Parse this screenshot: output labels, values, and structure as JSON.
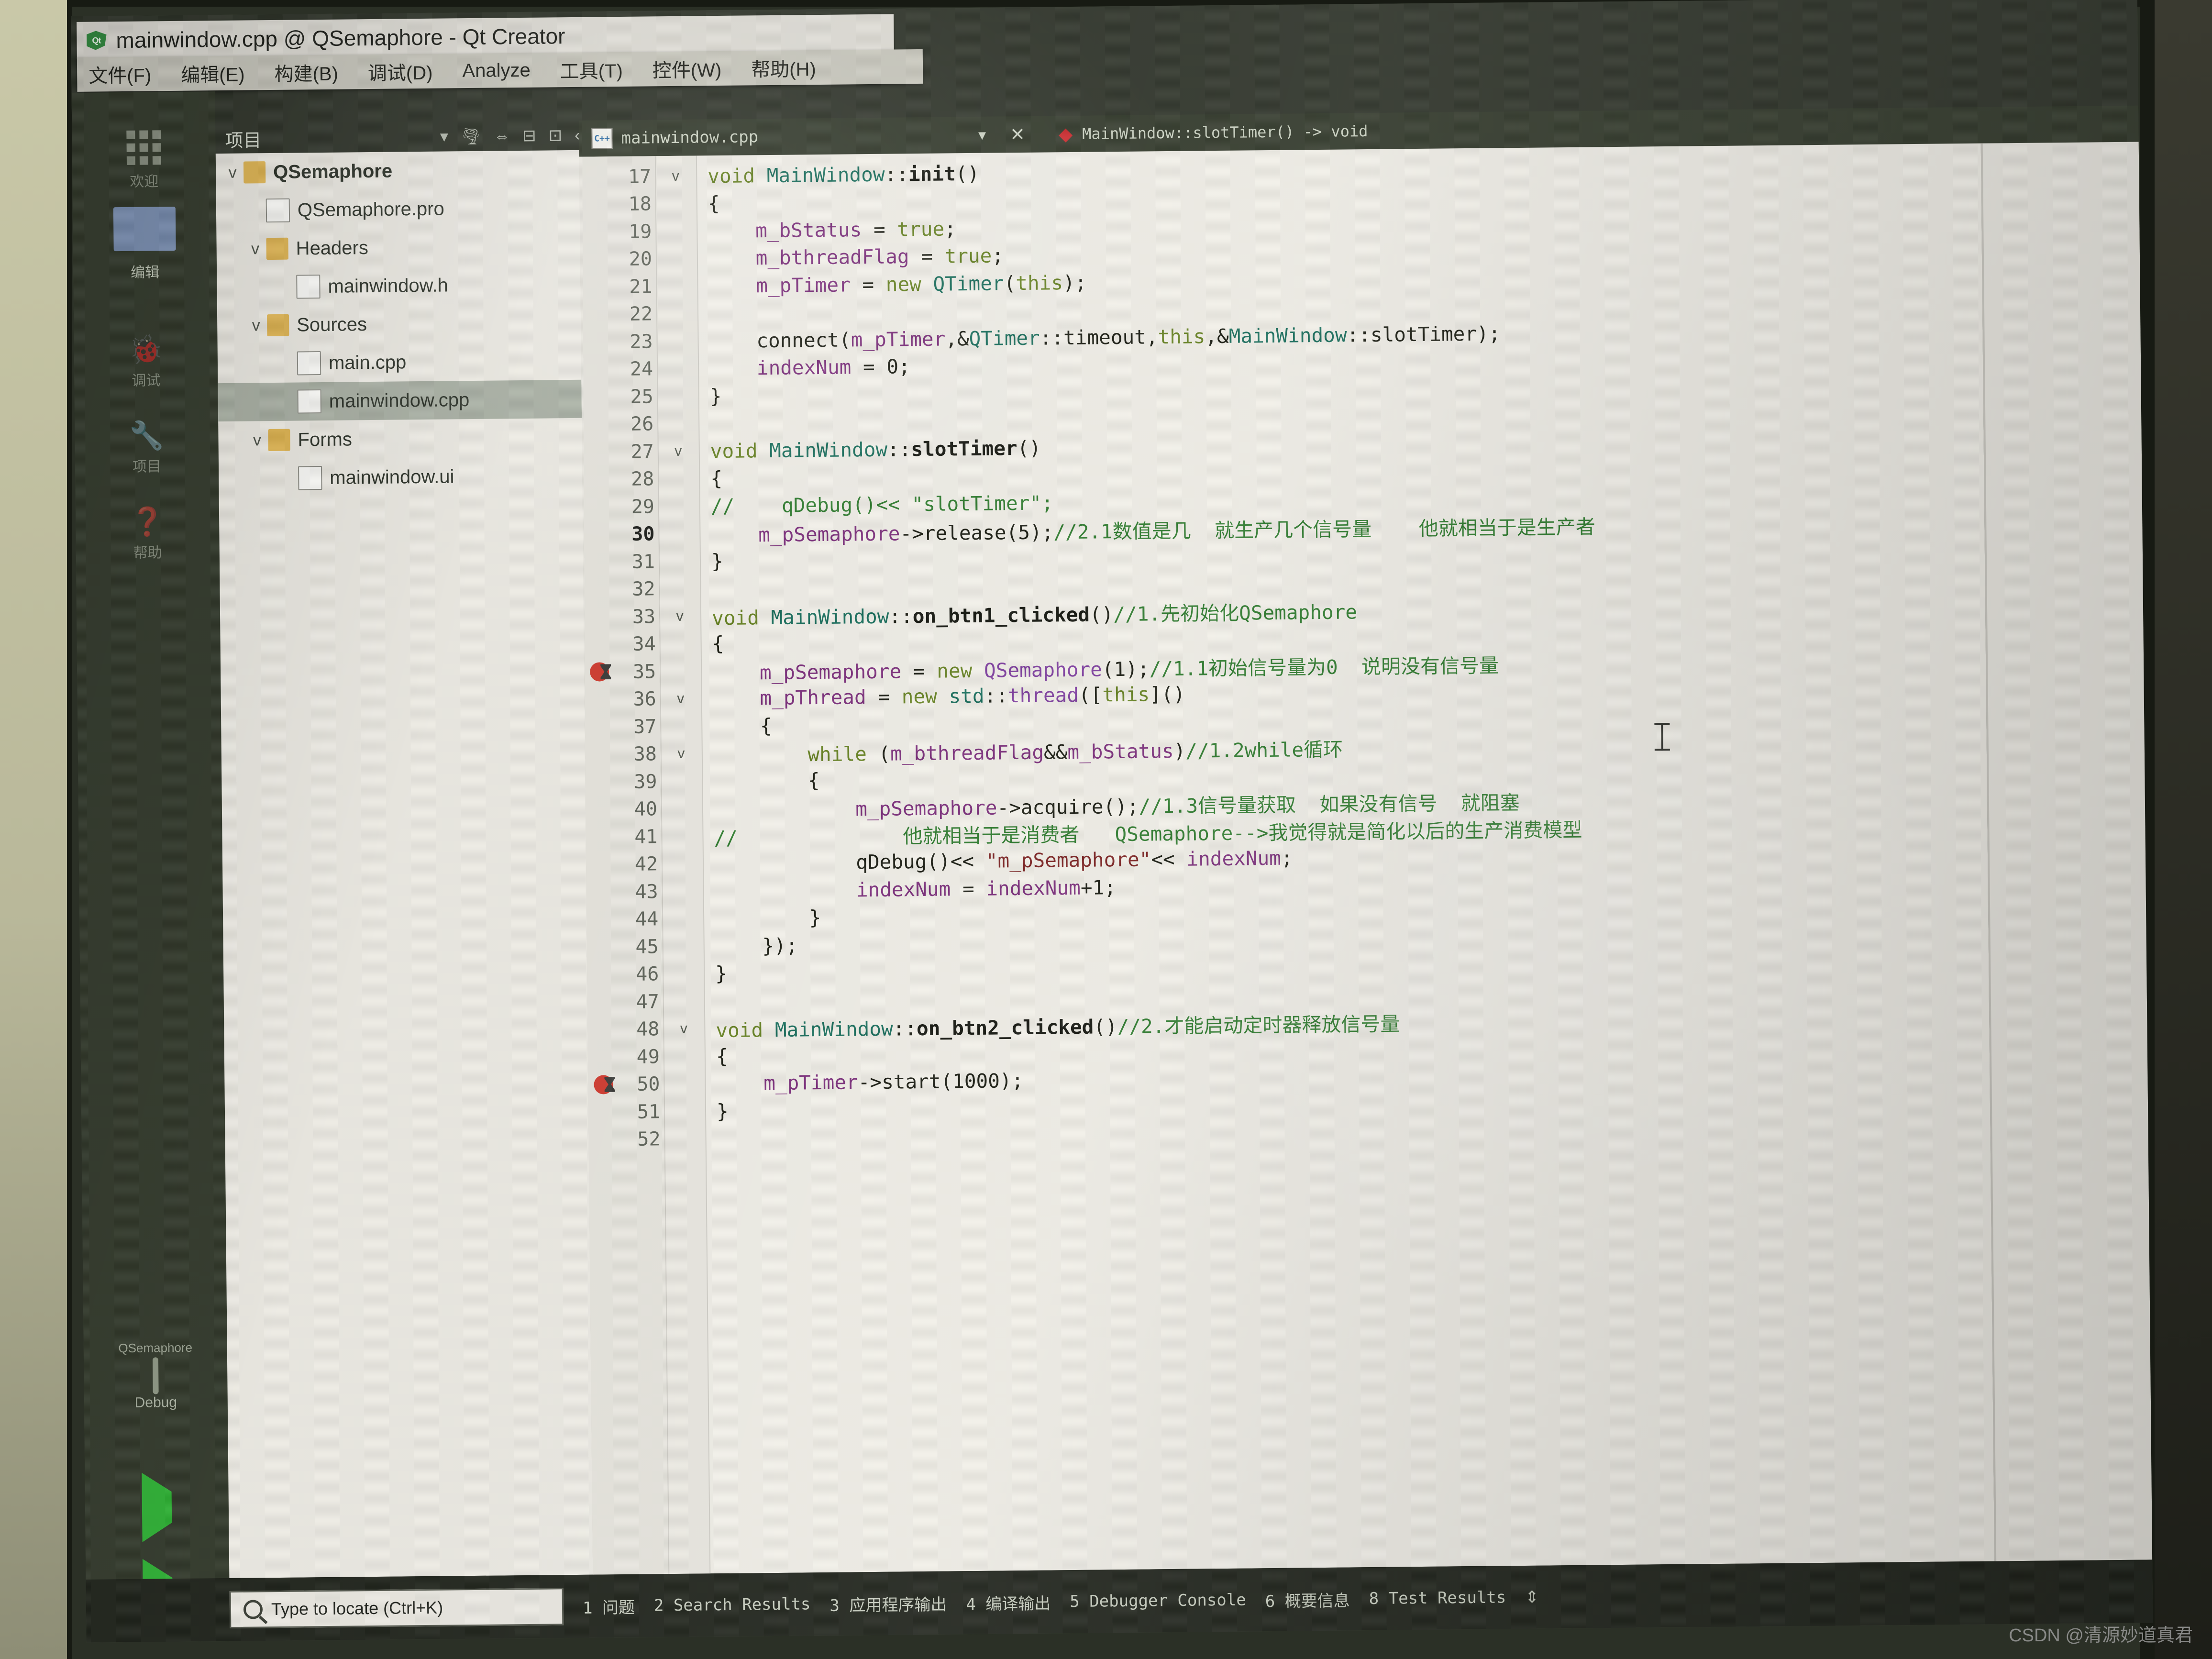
{
  "window": {
    "title": "mainwindow.cpp @ QSemaphore - Qt Creator",
    "app_icon": "qt-logo-icon"
  },
  "menubar": {
    "items": [
      {
        "label": "文件(F)",
        "name": "menu-file"
      },
      {
        "label": "编辑(E)",
        "name": "menu-edit"
      },
      {
        "label": "构建(B)",
        "name": "menu-build"
      },
      {
        "label": "调试(D)",
        "name": "menu-debug"
      },
      {
        "label": "Analyze",
        "name": "menu-analyze"
      },
      {
        "label": "工具(T)",
        "name": "menu-tools"
      },
      {
        "label": "控件(W)",
        "name": "menu-window"
      },
      {
        "label": "帮助(H)",
        "name": "menu-help"
      }
    ]
  },
  "modebar": {
    "welcome": "欢迎",
    "edit": "编辑",
    "debug": "调试",
    "tools": "项目",
    "help": "帮助",
    "kit_name": "QSemaphore",
    "kit_config": "Debug"
  },
  "sidebar": {
    "header": "项目",
    "tree": [
      {
        "label": "QSemaphore",
        "depth": 0,
        "icon": "folder",
        "arrow": "v",
        "bold": true,
        "selected": false
      },
      {
        "label": "QSemaphore.pro",
        "depth": 1,
        "icon": "file",
        "arrow": "",
        "bold": false,
        "selected": false
      },
      {
        "label": "Headers",
        "depth": 1,
        "icon": "folder",
        "arrow": "v",
        "bold": false,
        "selected": false
      },
      {
        "label": "mainwindow.h",
        "depth": 2,
        "icon": "file",
        "arrow": "",
        "bold": false,
        "selected": false
      },
      {
        "label": "Sources",
        "depth": 1,
        "icon": "folder",
        "arrow": "v",
        "bold": false,
        "selected": false
      },
      {
        "label": "main.cpp",
        "depth": 2,
        "icon": "file",
        "arrow": "",
        "bold": false,
        "selected": false
      },
      {
        "label": "mainwindow.cpp",
        "depth": 2,
        "icon": "file",
        "arrow": "",
        "bold": false,
        "selected": true
      },
      {
        "label": "Forms",
        "depth": 1,
        "icon": "folder",
        "arrow": "v",
        "bold": false,
        "selected": false
      },
      {
        "label": "mainwindow.ui",
        "depth": 2,
        "icon": "file",
        "arrow": "",
        "bold": false,
        "selected": false
      }
    ]
  },
  "editor": {
    "tab_label": "mainwindow.cpp",
    "breadcrumb": "MainWindow::slotTimer() -> void",
    "first_line": 17,
    "lines": [
      {
        "n": 17,
        "fold": "v",
        "bp": false,
        "html": "<span class=\"kw\">void</span> <span class=\"ty\">MainWindow</span>::<span class=\"fn\">init</span>()",
        "text": "void MainWindow::init()"
      },
      {
        "n": 18,
        "fold": "",
        "bp": false,
        "html": "{",
        "text": "{"
      },
      {
        "n": 19,
        "fold": "",
        "bp": false,
        "html": "    <span class=\"nm\">m_bStatus</span> = <span class=\"kw\">true</span>;",
        "text": "    m_bStatus = true;"
      },
      {
        "n": 20,
        "fold": "",
        "bp": false,
        "html": "    <span class=\"nm\">m_bthreadFlag</span> = <span class=\"kw\">true</span>;",
        "text": "    m_bthreadFlag = true;"
      },
      {
        "n": 21,
        "fold": "",
        "bp": false,
        "html": "    <span class=\"nm\">m_pTimer</span> = <span class=\"kw\">new</span> <span class=\"ty\">QTimer</span>(<span class=\"kw\">this</span>);",
        "text": "    m_pTimer = new QTimer(this);"
      },
      {
        "n": 22,
        "fold": "",
        "bp": false,
        "html": "",
        "text": ""
      },
      {
        "n": 23,
        "fold": "",
        "bp": false,
        "html": "    connect(<span class=\"nm\">m_pTimer</span>,&amp;<span class=\"ty\">QTimer</span>::timeout,<span class=\"kw\">this</span>,&amp;<span class=\"ty\">MainWindow</span>::slotTimer);",
        "text": "    connect(m_pTimer,&QTimer::timeout,this,&MainWindow::slotTimer);"
      },
      {
        "n": 24,
        "fold": "",
        "bp": false,
        "html": "    <span class=\"nm\">indexNum</span> = 0;",
        "text": "    indexNum = 0;"
      },
      {
        "n": 25,
        "fold": "",
        "bp": false,
        "html": "}",
        "text": "}"
      },
      {
        "n": 26,
        "fold": "",
        "bp": false,
        "html": "",
        "text": ""
      },
      {
        "n": 27,
        "fold": "v",
        "bp": false,
        "html": "<span class=\"kw\">void</span> <span class=\"ty\">MainWindow</span>::<span class=\"fn\">slotTimer</span>()",
        "text": "void MainWindow::slotTimer()"
      },
      {
        "n": 28,
        "fold": "",
        "bp": false,
        "html": "{",
        "text": "{"
      },
      {
        "n": 29,
        "fold": "",
        "bp": false,
        "html": "<span class=\"cm\">//    qDebug()&lt;&lt; \"slotTimer\";</span>",
        "text": "//    qDebug()<< \"slotTimer\";"
      },
      {
        "n": 30,
        "fold": "",
        "bp": false,
        "cur": true,
        "html": "    <span class=\"nm\">m_pSemaphore</span>-&gt;release(5);<span class=\"cm\">//2.1数值是几  就生产几个信号量    他就相当于是生产者</span>",
        "text": "    m_pSemaphore->release(5);//2.1数值是几  就生产几个信号量    他就相当于是生产者"
      },
      {
        "n": 31,
        "fold": "",
        "bp": false,
        "html": "}",
        "text": "}"
      },
      {
        "n": 32,
        "fold": "",
        "bp": false,
        "html": "",
        "text": ""
      },
      {
        "n": 33,
        "fold": "v",
        "bp": false,
        "html": "<span class=\"kw\">void</span> <span class=\"ty\">MainWindow</span>::<span class=\"fn\">on_btn1_clicked</span>()<span class=\"cm\">//1.先初始化QSemaphore</span>",
        "text": "void MainWindow::on_btn1_clicked()//1.先初始化QSemaphore"
      },
      {
        "n": 34,
        "fold": "",
        "bp": false,
        "html": "{",
        "text": "{"
      },
      {
        "n": 35,
        "fold": "",
        "bp": true,
        "html": "    <span class=\"nm\">m_pSemaphore</span> = <span class=\"kw\">new</span> <span class=\"pp\">QSemaphore</span>(1);<span class=\"cm\">//1.1初始信号量为0  说明没有信号量</span>",
        "text": "    m_pSemaphore = new QSemaphore(1);//1.1初始信号量为0  说明没有信号量"
      },
      {
        "n": 36,
        "fold": "v",
        "bp": false,
        "html": "    <span class=\"nm\">m_pThread</span> = <span class=\"kw\">new</span> <span class=\"ty\">std</span>::<span class=\"pp\">thread</span>([<span class=\"kw\">this</span>]()",
        "text": "    m_pThread = new std::thread([this]()"
      },
      {
        "n": 37,
        "fold": "",
        "bp": false,
        "html": "    {",
        "text": "    {"
      },
      {
        "n": 38,
        "fold": "v",
        "bp": false,
        "html": "        <span class=\"kw\">while</span> (<span class=\"nm\">m_bthreadFlag</span>&amp;&amp;<span class=\"nm\">m_bStatus</span>)<span class=\"cm\">//1.2while循环</span>",
        "text": "        while (m_bthreadFlag&&m_bStatus)//1.2while循环"
      },
      {
        "n": 39,
        "fold": "",
        "bp": false,
        "html": "        {",
        "text": "        {"
      },
      {
        "n": 40,
        "fold": "",
        "bp": false,
        "html": "            <span class=\"nm\">m_pSemaphore</span>-&gt;acquire();<span class=\"cm\">//1.3信号量获取  如果没有信号  就阻塞</span>",
        "text": "            m_pSemaphore->acquire();//1.3信号量获取  如果没有信号  就阻塞"
      },
      {
        "n": 41,
        "fold": "",
        "bp": false,
        "html": "<span class=\"cm\">//              他就相当于是消费者   QSemaphore--&gt;我觉得就是简化以后的生产消费模型</span>",
        "text": "//              他就相当于是消费者   QSemaphore-->我觉得就是简化以后的生产消费模型"
      },
      {
        "n": 42,
        "fold": "",
        "bp": false,
        "html": "            qDebug()&lt;&lt; <span class=\"st\">\"m_pSemaphore\"</span>&lt;&lt; <span class=\"nm\">indexNum</span>;",
        "text": "            qDebug()<< \"m_pSemaphore\"<< indexNum;"
      },
      {
        "n": 43,
        "fold": "",
        "bp": false,
        "html": "            <span class=\"nm\">indexNum</span> = <span class=\"nm\">indexNum</span>+1;",
        "text": "            indexNum = indexNum+1;"
      },
      {
        "n": 44,
        "fold": "",
        "bp": false,
        "html": "        }",
        "text": "        }"
      },
      {
        "n": 45,
        "fold": "",
        "bp": false,
        "html": "    });",
        "text": "    });"
      },
      {
        "n": 46,
        "fold": "",
        "bp": false,
        "html": "}",
        "text": "}"
      },
      {
        "n": 47,
        "fold": "",
        "bp": false,
        "html": "",
        "text": ""
      },
      {
        "n": 48,
        "fold": "v",
        "bp": false,
        "html": "<span class=\"kw\">void</span> <span class=\"ty\">MainWindow</span>::<span class=\"fn\">on_btn2_clicked</span>()<span class=\"cm\">//2.才能启动定时器释放信号量</span>",
        "text": "void MainWindow::on_btn2_clicked()//2.才能启动定时器释放信号量"
      },
      {
        "n": 49,
        "fold": "",
        "bp": false,
        "html": "{",
        "text": "{"
      },
      {
        "n": 50,
        "fold": "",
        "bp": true,
        "html": "    <span class=\"nm\">m_pTimer</span>-&gt;start(1000);",
        "text": "    m_pTimer->start(1000);"
      },
      {
        "n": 51,
        "fold": "",
        "bp": false,
        "html": "}",
        "text": "}"
      },
      {
        "n": 52,
        "fold": "",
        "bp": false,
        "html": "",
        "text": ""
      }
    ]
  },
  "statusbar": {
    "locate_placeholder": "Type to locate (Ctrl+K)",
    "panes": [
      "1 问题",
      "2 Search Results",
      "3 应用程序输出",
      "4 编译输出",
      "5 Debugger Console",
      "6 概要信息",
      "8 Test Results"
    ],
    "updown": "⇕"
  },
  "watermark": "CSDN @清源妙道真君",
  "colors": {
    "accent_green": "#2fb035",
    "breakpoint_red": "#cf3a2e",
    "selection": "#a9b0a4",
    "chrome_dark": "#333a2c",
    "editor_bg": "#f0eee7"
  }
}
